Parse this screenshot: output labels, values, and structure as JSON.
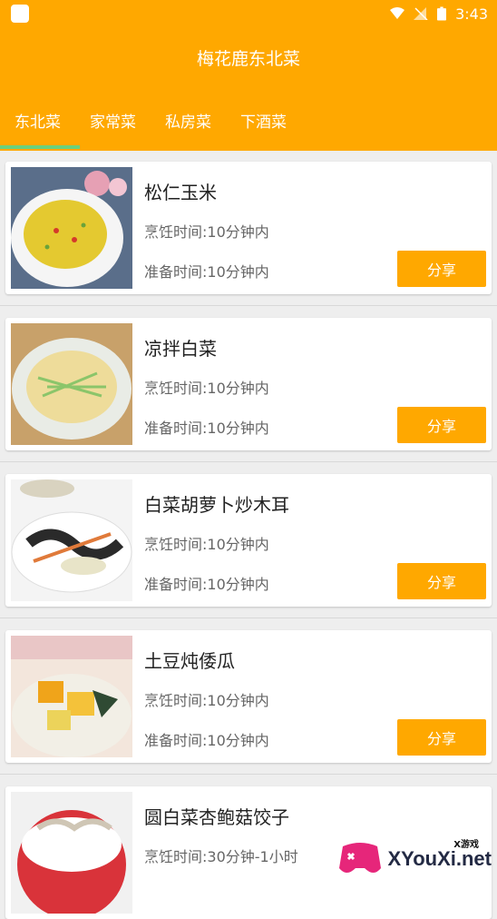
{
  "status_bar": {
    "time": "3:43"
  },
  "app": {
    "title": "梅花鹿东北菜"
  },
  "tabs": [
    {
      "label": "东北菜",
      "active": true
    },
    {
      "label": "家常菜",
      "active": false
    },
    {
      "label": "私房菜",
      "active": false
    },
    {
      "label": "下酒菜",
      "active": false
    }
  ],
  "dishes": [
    {
      "name": "松仁玉米",
      "cook_time": "烹饪时间:10分钟内",
      "prep_time": "准备时间:10分钟内",
      "share_label": "分享"
    },
    {
      "name": "凉拌白菜",
      "cook_time": "烹饪时间:10分钟内",
      "prep_time": "准备时间:10分钟内",
      "share_label": "分享"
    },
    {
      "name": "白菜胡萝卜炒木耳",
      "cook_time": "烹饪时间:10分钟内",
      "prep_time": "准备时间:10分钟内",
      "share_label": "分享"
    },
    {
      "name": "土豆炖倭瓜",
      "cook_time": "烹饪时间:10分钟内",
      "prep_time": "准备时间:10分钟内",
      "share_label": "分享"
    },
    {
      "name": "圆白菜杏鲍菇饺子",
      "cook_time": "烹饪时间:30分钟-1小时",
      "prep_time": "",
      "share_label": ""
    }
  ],
  "watermark": {
    "text": "XYouXi.net",
    "small": "X游戏"
  },
  "colors": {
    "primary": "#ffa800",
    "indicator": "#6bd07b"
  }
}
